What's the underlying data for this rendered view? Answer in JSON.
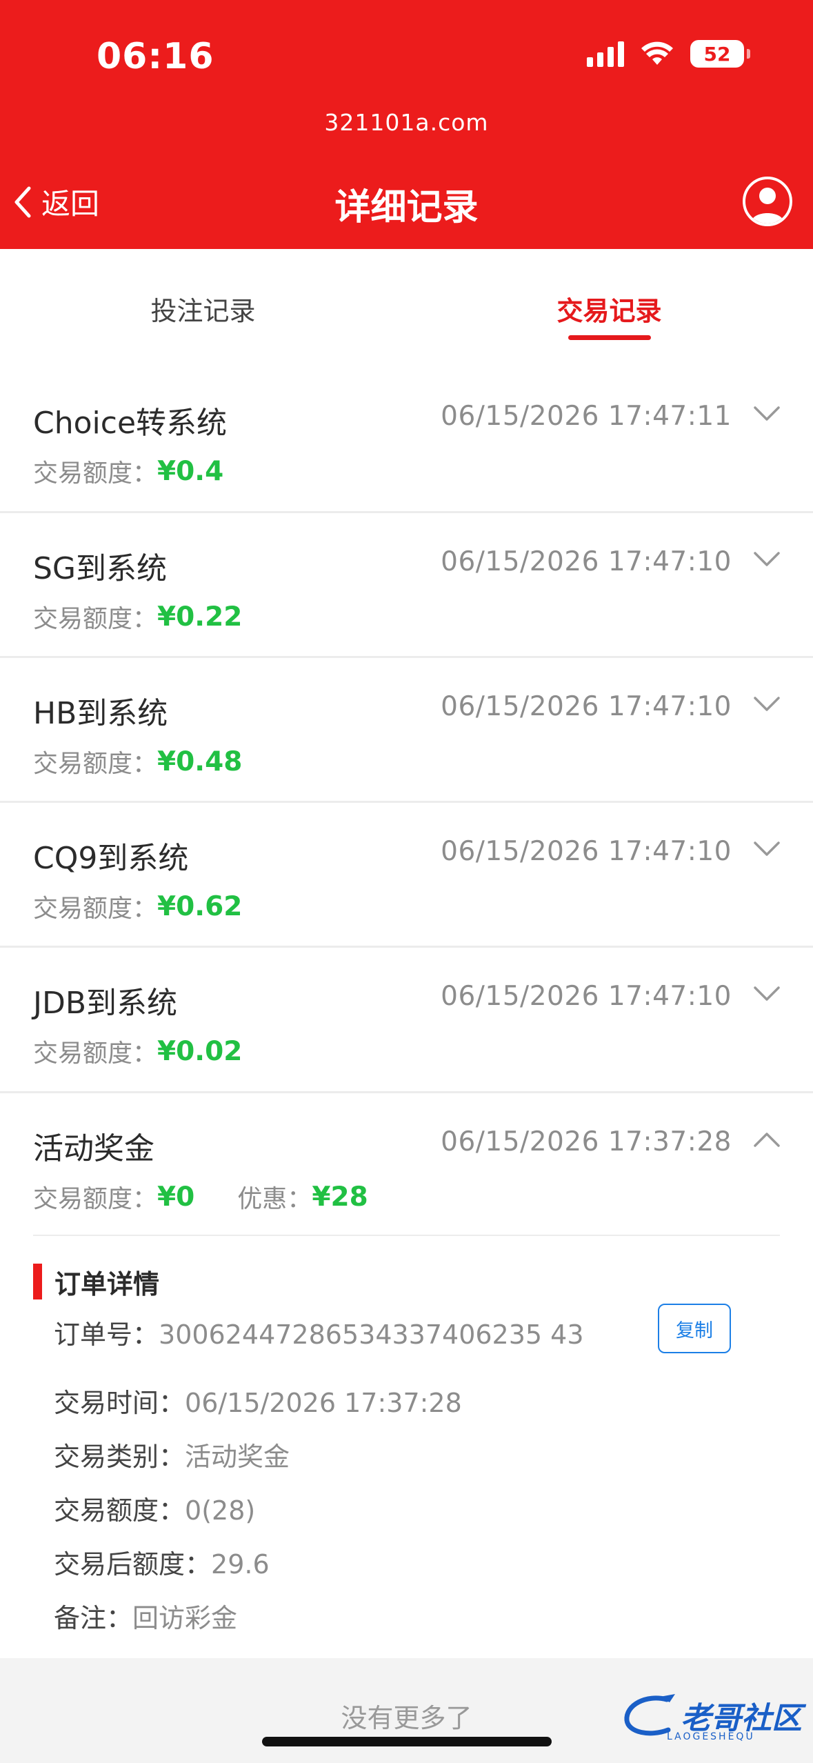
{
  "status_bar": {
    "time": "06:16",
    "battery": "52"
  },
  "header": {
    "url": "321101a.com",
    "back_label": "返回",
    "title": "详细记录"
  },
  "tabs": [
    {
      "label": "投注记录",
      "active": false
    },
    {
      "label": "交易记录",
      "active": true
    }
  ],
  "amount_label": "交易额度：",
  "records": [
    {
      "name": "Choice转系统",
      "date": "06/15/2026 17:47:11",
      "amount": "¥0.4"
    },
    {
      "name": "SG到系统",
      "date": "06/15/2026 17:47:10",
      "amount": "¥0.22"
    },
    {
      "name": "HB到系统",
      "date": "06/15/2026 17:47:10",
      "amount": "¥0.48"
    },
    {
      "name": "CQ9到系统",
      "date": "06/15/2026 17:47:10",
      "amount": "¥0.62"
    },
    {
      "name": "JDB到系统",
      "date": "06/15/2026 17:47:10",
      "amount": "¥0.02"
    }
  ],
  "expanded": {
    "name": "活动奖金",
    "date": "06/15/2026 17:37:28",
    "amount": "¥0",
    "discount_label": "优惠：",
    "discount": "¥28",
    "detail_title": "订单详情",
    "order_no_label": "订单号：",
    "order_no": "30062447286534337406235 43",
    "copy_label": "复制",
    "time_label": "交易时间：",
    "time": "06/15/2026 17:37:28",
    "type_label": "交易类别：",
    "type": "活动奖金",
    "amount_label": "交易额度：",
    "amount_detail": "0(28)",
    "after_label": "交易后额度：",
    "after": "29.6",
    "remark_label": "备注：",
    "remark": "回访彩金"
  },
  "footer": {
    "no_more": "没有更多了",
    "watermark": "老哥社区",
    "watermark_sub": "LAOGESHEQU"
  },
  "colors": {
    "brand_red": "#ec1c1c",
    "amount_green": "#21c043",
    "link_blue": "#1c7fe6"
  }
}
